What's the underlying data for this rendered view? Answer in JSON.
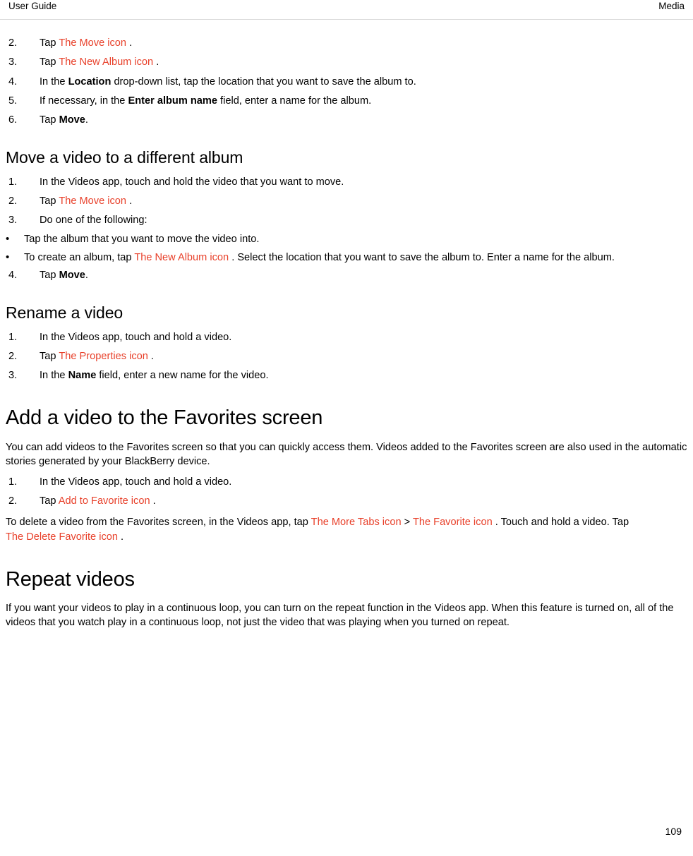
{
  "header": {
    "left": "User Guide",
    "right": "Media"
  },
  "footer": {
    "page_number": "109"
  },
  "accent_color": "#e8402a",
  "sections": [
    {
      "id": "move-photo-steps",
      "steps": [
        {
          "num": "2.",
          "pre": "Tap ",
          "link": "The Move icon",
          "post": " ."
        },
        {
          "num": "3.",
          "pre": "Tap ",
          "link": "The New Album icon",
          "post": " ."
        },
        {
          "num": "4.",
          "pre": "In the ",
          "bold": "Location",
          "post": " drop-down list, tap the location that you want to save the album to."
        },
        {
          "num": "5.",
          "pre": "If necessary, in the ",
          "bold": "Enter album name",
          "post": " field, enter a name for the album."
        },
        {
          "num": "6.",
          "pre": "Tap ",
          "bold": "Move",
          "post": "."
        }
      ]
    },
    {
      "id": "move-video",
      "heading": "Move a video to a different album",
      "steps": [
        {
          "num": "1.",
          "pre": "In the Videos app, touch and hold the video that you want to move.",
          "post": ""
        },
        {
          "num": "2.",
          "pre": "Tap ",
          "link": "The Move icon",
          "post": " ."
        },
        {
          "num": "3.",
          "pre": "Do one of the following:",
          "post": ""
        },
        {
          "num": "4.",
          "pre": "Tap ",
          "bold": "Move",
          "post": "."
        }
      ],
      "bullets": [
        {
          "pre": " Tap the album that you want to move the video into.",
          "post": ""
        },
        {
          "pre": "To create an album, tap ",
          "link": "The New Album icon",
          "post": " . Select the location that you want to save the album to. Enter a name for the album."
        }
      ]
    },
    {
      "id": "rename-video",
      "heading": "Rename a video",
      "steps": [
        {
          "num": "1.",
          "pre": "In the Videos app, touch and hold a video.",
          "post": ""
        },
        {
          "num": "2.",
          "pre": "Tap ",
          "link": "The Properties icon",
          "post": " ."
        },
        {
          "num": "3.",
          "pre": "In the ",
          "bold": "Name",
          "post": " field, enter a new name for the video."
        }
      ]
    },
    {
      "id": "add-favorites",
      "heading": "Add a video to the Favorites screen",
      "intro": "You can add videos to the Favorites screen so that you can quickly access them. Videos added to the Favorites screen are also used in the automatic stories generated by your BlackBerry device.",
      "steps": [
        {
          "num": "1.",
          "pre": "In the Videos app, touch and hold a video.",
          "post": ""
        },
        {
          "num": "2.",
          "pre": "Tap ",
          "link": "Add to Favorite icon",
          "post": " ."
        }
      ],
      "outro": {
        "part1": "To delete a video from the Favorites screen, in the Videos app, tap ",
        "link1": "The More Tabs icon",
        "part2": " > ",
        "link2": "The Favorite icon",
        "part3": " . Touch and hold a video. Tap ",
        "link3": "The Delete Favorite icon",
        "part4": " ."
      }
    },
    {
      "id": "repeat-videos",
      "heading": "Repeat videos",
      "intro": "If you want your videos to play in a continuous loop, you can turn on the repeat function in the Videos app. When this feature is turned on, all of the videos that you watch play in a continuous loop, not just the video that was playing when you turned on repeat."
    }
  ]
}
